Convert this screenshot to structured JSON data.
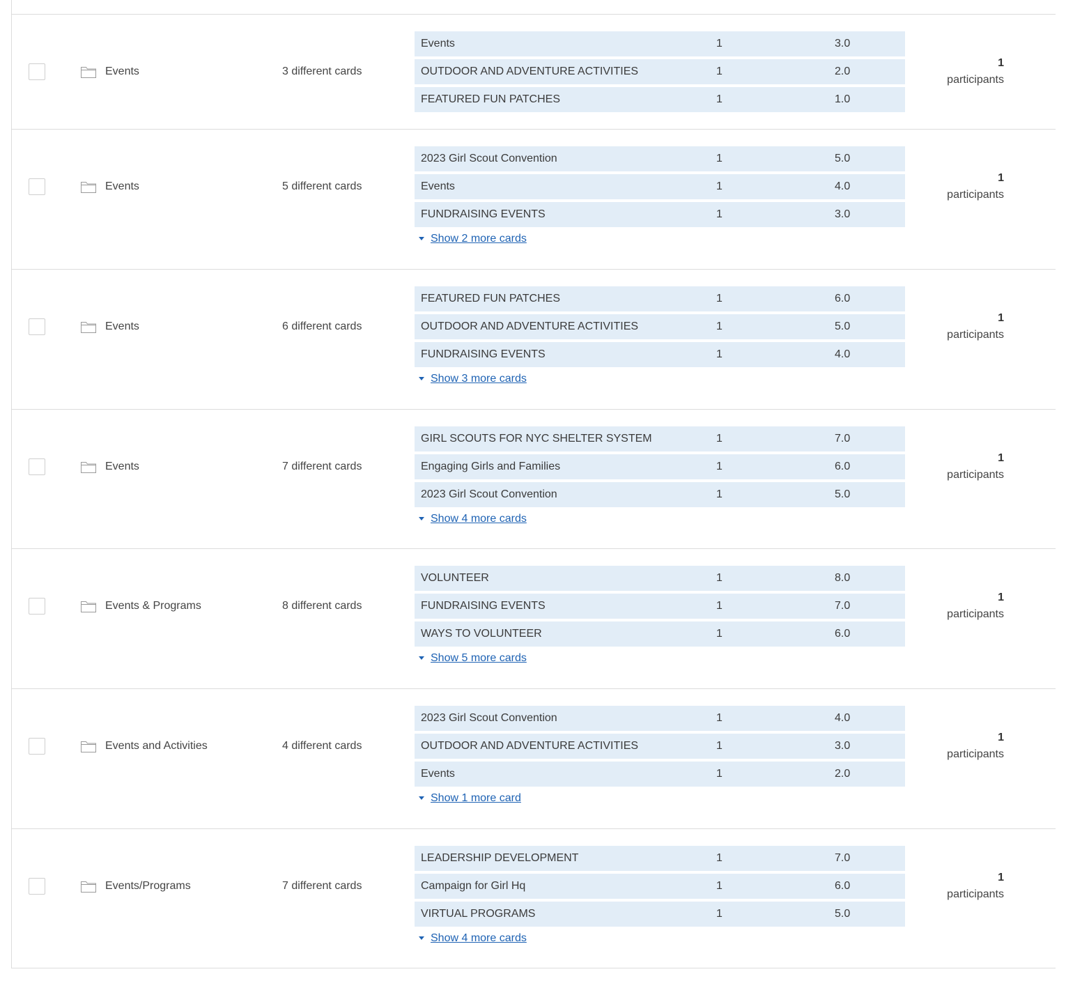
{
  "colors": {
    "card_background": "#e2edf7",
    "link": "#1f63b4",
    "divider": "#dcdcdc",
    "text": "#444444"
  },
  "rows": [
    {
      "folder": "Events",
      "cards_count": "3 different cards",
      "cards": [
        {
          "name": "Events",
          "count": "1",
          "score": "3.0"
        },
        {
          "name": "OUTDOOR AND ADVENTURE ACTIVITIES",
          "count": "1",
          "score": "2.0"
        },
        {
          "name": "FEATURED FUN PATCHES",
          "count": "1",
          "score": "1.0"
        }
      ],
      "show_more": "",
      "participants_count": "1",
      "participants_label": "participants"
    },
    {
      "folder": "Events",
      "cards_count": "5 different cards",
      "cards": [
        {
          "name": "2023 Girl Scout Convention",
          "count": "1",
          "score": "5.0"
        },
        {
          "name": "Events",
          "count": "1",
          "score": "4.0"
        },
        {
          "name": "FUNDRAISING EVENTS",
          "count": "1",
          "score": "3.0"
        }
      ],
      "show_more": "Show 2 more cards",
      "participants_count": "1",
      "participants_label": "participants"
    },
    {
      "folder": "Events",
      "cards_count": "6 different cards",
      "cards": [
        {
          "name": "FEATURED FUN PATCHES",
          "count": "1",
          "score": "6.0"
        },
        {
          "name": "OUTDOOR AND ADVENTURE ACTIVITIES",
          "count": "1",
          "score": "5.0"
        },
        {
          "name": "FUNDRAISING EVENTS",
          "count": "1",
          "score": "4.0"
        }
      ],
      "show_more": "Show 3 more cards",
      "participants_count": "1",
      "participants_label": "participants"
    },
    {
      "folder": "Events",
      "cards_count": "7 different cards",
      "cards": [
        {
          "name": "GIRL SCOUTS FOR NYC SHELTER SYSTEM",
          "count": "1",
          "score": "7.0"
        },
        {
          "name": "Engaging Girls and Families",
          "count": "1",
          "score": "6.0"
        },
        {
          "name": "2023 Girl Scout Convention",
          "count": "1",
          "score": "5.0"
        }
      ],
      "show_more": "Show 4 more cards",
      "participants_count": "1",
      "participants_label": "participants"
    },
    {
      "folder": "Events & Programs",
      "cards_count": "8 different cards",
      "cards": [
        {
          "name": "VOLUNTEER",
          "count": "1",
          "score": "8.0"
        },
        {
          "name": "FUNDRAISING EVENTS",
          "count": "1",
          "score": "7.0"
        },
        {
          "name": "WAYS TO VOLUNTEER",
          "count": "1",
          "score": "6.0"
        }
      ],
      "show_more": "Show 5 more cards",
      "participants_count": "1",
      "participants_label": "participants"
    },
    {
      "folder": "Events and Activities",
      "cards_count": "4 different cards",
      "cards": [
        {
          "name": "2023 Girl Scout Convention",
          "count": "1",
          "score": "4.0"
        },
        {
          "name": "OUTDOOR AND ADVENTURE ACTIVITIES",
          "count": "1",
          "score": "3.0"
        },
        {
          "name": "Events",
          "count": "1",
          "score": "2.0"
        }
      ],
      "show_more": "Show 1 more card",
      "participants_count": "1",
      "participants_label": "participants"
    },
    {
      "folder": "Events/Programs",
      "cards_count": "7 different cards",
      "cards": [
        {
          "name": "LEADERSHIP DEVELOPMENT",
          "count": "1",
          "score": "7.0"
        },
        {
          "name": "Campaign for Girl Hq",
          "count": "1",
          "score": "6.0"
        },
        {
          "name": "VIRTUAL PROGRAMS",
          "count": "1",
          "score": "5.0"
        }
      ],
      "show_more": "Show 4 more cards",
      "participants_count": "1",
      "participants_label": "participants"
    }
  ]
}
